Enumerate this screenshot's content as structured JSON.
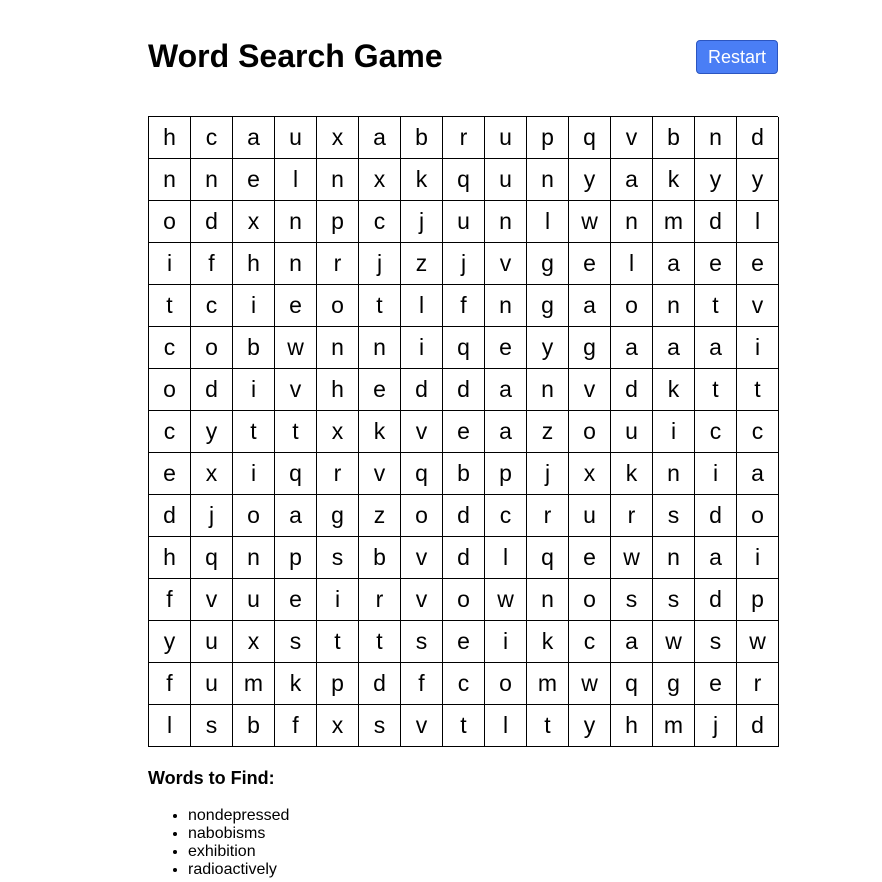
{
  "title": "Word Search Game",
  "restart_label": "Restart",
  "accent_color": "#4a7ef5",
  "grid": [
    "hcauxabrupqvbnd",
    "nnelnxkqunyakyy",
    "odxnpcjunlwnmdl",
    "ifhnrjzjvgelaee",
    "tcieotlfngaontv",
    "cobwnniqeygaaai",
    "odivheddanvdktt",
    "cyttxkveazouicc",
    "exiqrvqbpjxknia",
    "djoagzodcrursdo",
    "hqnpsbvdlqewnai",
    "fvueirvownossdp",
    "yuxsttseikcawswa",
    "fumkpdfcomwqger",
    "lsbfxsvtltyhmjd"
  ],
  "words_heading": "Words to Find:",
  "words": [
    "nondepressed",
    "nabobisms",
    "exhibition",
    "radioactively"
  ]
}
